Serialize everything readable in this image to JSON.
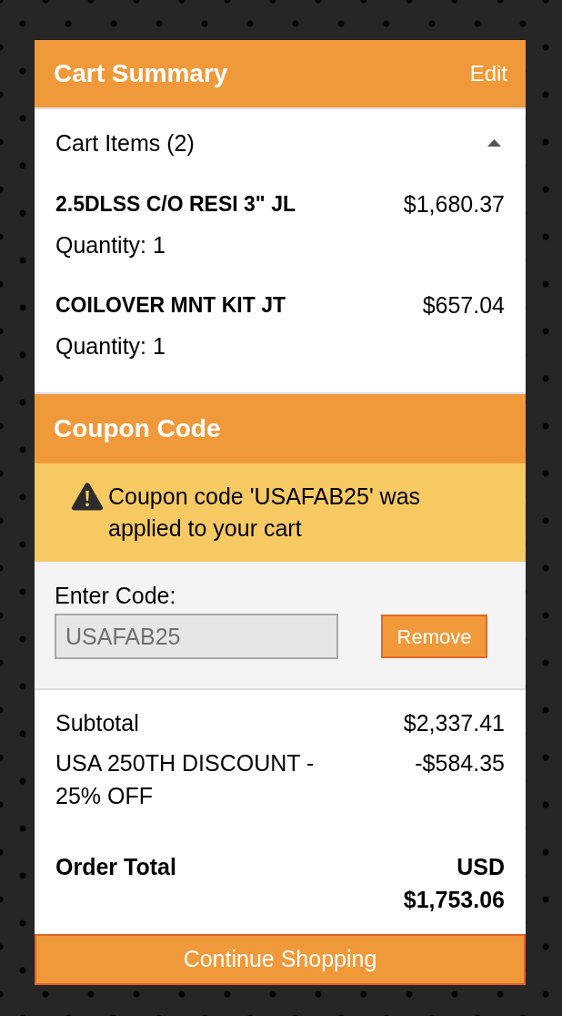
{
  "cart_summary": {
    "title": "Cart Summary",
    "edit_link": "Edit"
  },
  "cart_items": {
    "label": "Cart Items (2)",
    "expanded": true,
    "items": [
      {
        "name": "2.5DLSS C/O RESI 3\" JL",
        "price": "$1,680.37",
        "quantity": "Quantity: 1"
      },
      {
        "name": "COILOVER MNT KIT JT",
        "price": "$657.04",
        "quantity": "Quantity: 1"
      }
    ]
  },
  "coupon": {
    "title": "Coupon Code",
    "alert": "Coupon code 'USAFAB25' was applied to your cart",
    "field": {
      "label": "Enter Code:",
      "value": "USAFAB25",
      "disabled": true
    },
    "button": "Remove"
  },
  "totals": {
    "rows": [
      {
        "label": "Subtotal",
        "value": "$2,337.41"
      },
      {
        "label": "USA 250TH DISCOUNT - 25% OFF",
        "value": "-$584.35"
      }
    ],
    "order_total": {
      "label": "Order Total",
      "value": "USD $1,753.06"
    }
  },
  "continue_button": "Continue Shopping"
}
